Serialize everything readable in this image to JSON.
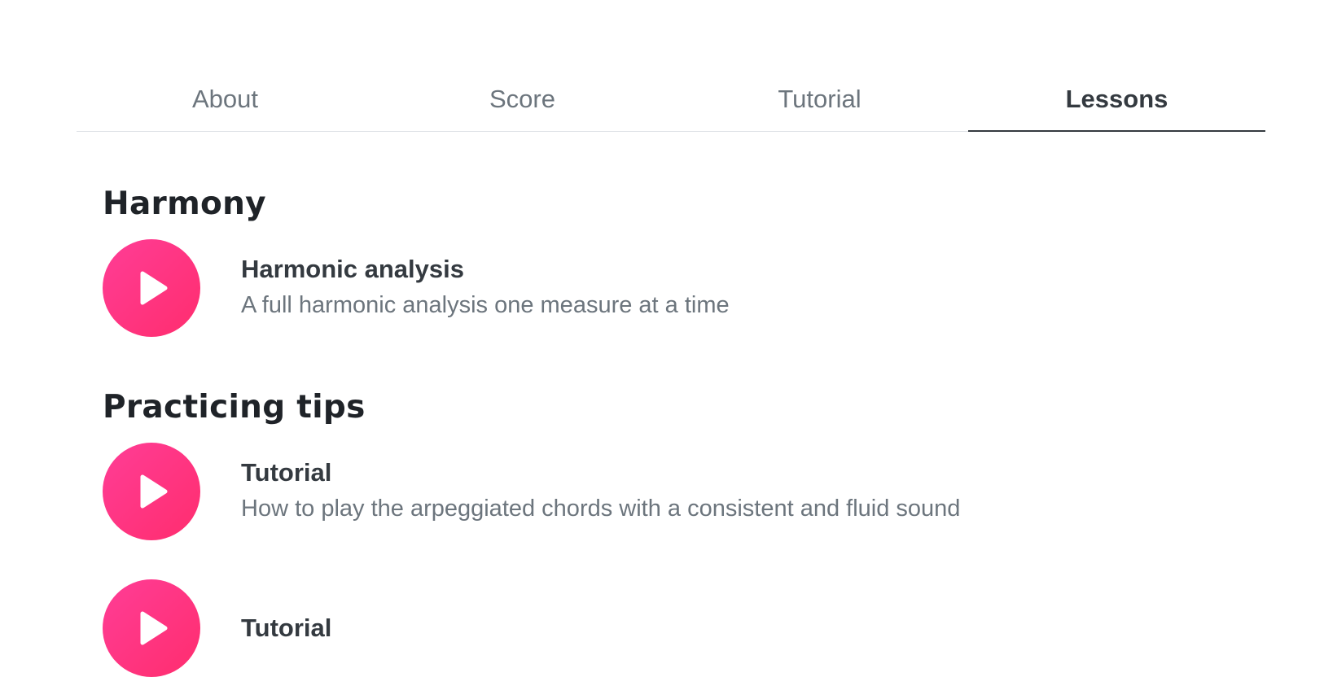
{
  "tabs": [
    {
      "label": "About",
      "active": false
    },
    {
      "label": "Score",
      "active": false
    },
    {
      "label": "Tutorial",
      "active": false
    },
    {
      "label": "Lessons",
      "active": true
    }
  ],
  "sections": [
    {
      "title": "Harmony",
      "lessons": [
        {
          "icon": "play-icon",
          "title": "Harmonic analysis",
          "description": "A full harmonic analysis one measure at a time"
        }
      ]
    },
    {
      "title": "Practicing tips",
      "lessons": [
        {
          "icon": "play-icon",
          "title": "Tutorial",
          "description": "How to play the arpeggiated chords with a consistent and fluid sound"
        },
        {
          "icon": "play-icon",
          "title": "Tutorial",
          "description": ""
        }
      ]
    }
  ],
  "colors": {
    "accent_start": "#ff3d96",
    "accent_end": "#ff2d6e",
    "muted_text": "#6c757d",
    "active_tab": "#343a40"
  }
}
